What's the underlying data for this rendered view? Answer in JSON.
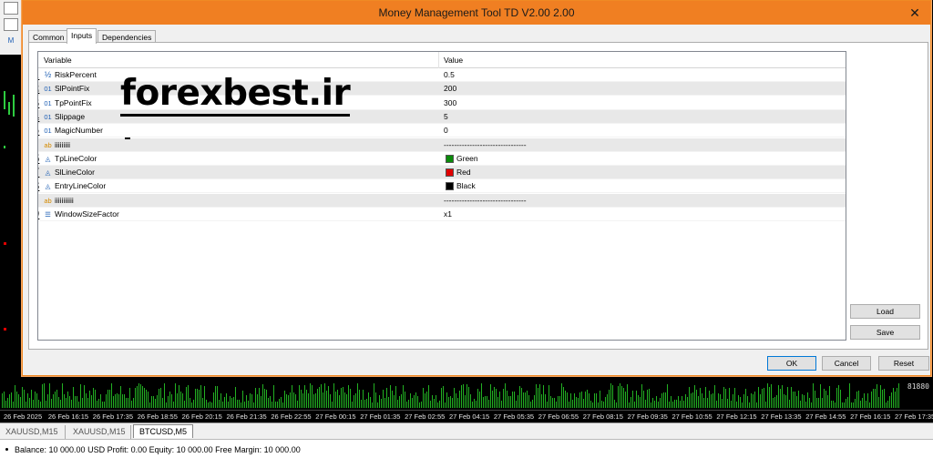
{
  "dialog": {
    "title": "Money Management Tool TD V2.00 2.00",
    "close_glyph": "✕",
    "tabs": [
      "Common",
      "Inputs",
      "Dependencies"
    ],
    "active_tab": "Inputs",
    "grid": {
      "headers": {
        "variable": "Variable",
        "value": "Value"
      },
      "rows": [
        {
          "num": "1",
          "icon": "½",
          "icon_name": "fraction-icon",
          "variable": "RiskPercent",
          "value": "0.5",
          "alt": false
        },
        {
          "num": "2",
          "icon": "01",
          "icon_name": "integer-icon",
          "variable": "SlPointFix",
          "value": "200",
          "alt": true
        },
        {
          "num": "3",
          "icon": "01",
          "icon_name": "integer-icon",
          "variable": "TpPointFix",
          "value": "300",
          "alt": false
        },
        {
          "num": "4",
          "icon": "01",
          "icon_name": "integer-icon",
          "variable": "Slippage",
          "value": "5",
          "alt": true
        },
        {
          "num": "5",
          "icon": "01",
          "icon_name": "integer-icon",
          "variable": "MagicNumber",
          "value": "0",
          "alt": false
        },
        {
          "num": "",
          "icon": "ab",
          "icon_name": "string-icon",
          "variable": "iiiiiiiii",
          "value": "--------------------------------",
          "alt": true
        },
        {
          "num": "6",
          "icon": "◬",
          "icon_name": "color-icon",
          "variable": "TpLineColor",
          "value": "Green",
          "swatch": "#0a8a0a",
          "alt": false
        },
        {
          "num": "7",
          "icon": "◬",
          "icon_name": "color-icon",
          "variable": "SlLineColor",
          "value": "Red",
          "swatch": "#e00000",
          "alt": true
        },
        {
          "num": "8",
          "icon": "◬",
          "icon_name": "color-icon",
          "variable": "EntryLineColor",
          "value": "Black",
          "swatch": "#000000",
          "alt": false
        },
        {
          "num": "",
          "icon": "ab",
          "icon_name": "string-icon",
          "variable": "iiiiiiiiiii",
          "value": "--------------------------------",
          "alt": true
        },
        {
          "num": "9",
          "icon": "☰",
          "icon_name": "enum-icon",
          "variable": "WindowSizeFactor",
          "value": "x1",
          "alt": false
        }
      ]
    },
    "watermark": "forexbest.ir",
    "buttons": {
      "load": "Load",
      "save": "Save",
      "ok": "OK",
      "cancel": "Cancel",
      "reset": "Reset"
    }
  },
  "terminal": {
    "price_label": "81880",
    "time_axis": [
      "26 Feb 2025",
      "26 Feb 16:15",
      "26 Feb 17:35",
      "26 Feb 18:55",
      "26 Feb 20:15",
      "26 Feb 21:35",
      "26 Feb 22:55",
      "27 Feb 00:15",
      "27 Feb 01:35",
      "27 Feb 02:55",
      "27 Feb 04:15",
      "27 Feb 05:35",
      "27 Feb 06:55",
      "27 Feb 08:15",
      "27 Feb 09:35",
      "27 Feb 10:55",
      "27 Feb 12:15",
      "27 Feb 13:35",
      "27 Feb 14:55",
      "27 Feb 16:15",
      "27 Feb 17:35"
    ],
    "chart_tabs": [
      "XAUUSD,M15",
      "XAUUSD,M15",
      "BTCUSD,M5"
    ],
    "active_chart_tab": "BTCUSD,M5",
    "status": "Balance: 10 000.00 USD  Profit: 0.00  Equity: 10 000.00  Free Margin: 10 000.00"
  }
}
